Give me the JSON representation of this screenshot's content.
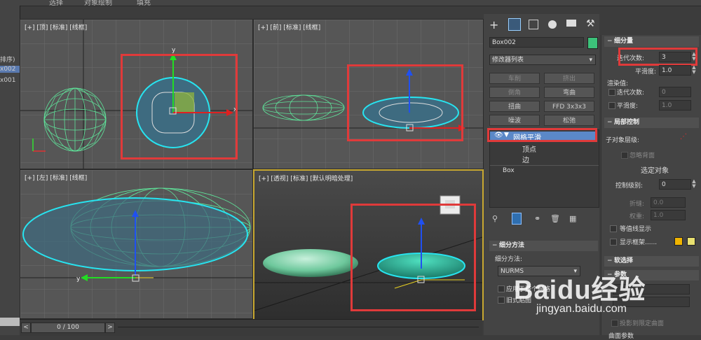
{
  "menubar": {
    "items": [
      "选择",
      "对象绘制",
      "填充"
    ]
  },
  "scene_explorer": {
    "items": [
      "排序)",
      "x002",
      "x001"
    ]
  },
  "viewports": {
    "top": {
      "label": "[+] [顶] [标准] [线框]"
    },
    "front": {
      "label": "[+] [前] [标准] [线框]"
    },
    "left": {
      "label": "[+] [左] [标准] [线框]"
    },
    "persp": {
      "label": "[+] [透视] [标准] [默认明暗处理]"
    }
  },
  "axes": {
    "x": "x",
    "y": "y",
    "z": "z"
  },
  "timeline": {
    "frame": "0 / 100",
    "prev": "<",
    "next": ">"
  },
  "command_panel": {
    "tabs": [
      "create-icon",
      "modify-icon",
      "hierarchy-icon",
      "motion-icon",
      "display-icon",
      "utilities-icon"
    ],
    "object_name": "Box002",
    "object_color": "#3cc27a",
    "modifier_list": "修改器列表",
    "modifier_buttons": [
      {
        "label": "车削",
        "enabled": false
      },
      {
        "label": "挤出",
        "enabled": false
      },
      {
        "label": "倒角",
        "enabled": false
      },
      {
        "label": "弯曲",
        "enabled": true
      },
      {
        "label": "扭曲",
        "enabled": true
      },
      {
        "label": "FFD 3x3x3",
        "enabled": true
      },
      {
        "label": "噪波",
        "enabled": true
      },
      {
        "label": "松弛",
        "enabled": true
      }
    ],
    "stack": {
      "active": "网格平滑",
      "children": [
        "顶点",
        "边"
      ],
      "base": "Box"
    },
    "subdivision_method": {
      "header": "细分方法",
      "label": "细分方法:",
      "value": "NURMS",
      "apply_whole": "应用于整个网格",
      "old_style": "旧式贴图"
    }
  },
  "right_panel": {
    "subdivision_amount": {
      "header": "细分量",
      "iterations_label": "迭代次数:",
      "iterations_value": "3",
      "smoothness_label": "平滑度:",
      "smoothness_value": "1.0",
      "render_values": "渲染值:",
      "render_iterations_label": "迭代次数:",
      "render_iterations_value": "0",
      "render_smoothness_label": "平滑度:",
      "render_smoothness_value": "1.0"
    },
    "local_control": {
      "header": "局部控制",
      "sublevel_label": "子对象层级:",
      "ignore_backface": "忽略背面",
      "selected_object": "选定对象",
      "control_level_label": "控制级别:",
      "control_level_value": "0",
      "crease_label": "折缝:",
      "crease_value": "0.0",
      "weight_label": "权重:",
      "weight_value": "1.0",
      "isoline_display": "等值线显示",
      "show_cage": "显示框架......"
    },
    "cage_colors": [
      "#f0b400",
      "#e8e070"
    ],
    "soft_selection": "软选择",
    "params_header": "参数",
    "project_label": "投影到限定曲面",
    "surface_params": "曲面参数"
  },
  "watermark": {
    "text": "Baidu经验",
    "url": "jingyan.baidu.com"
  }
}
